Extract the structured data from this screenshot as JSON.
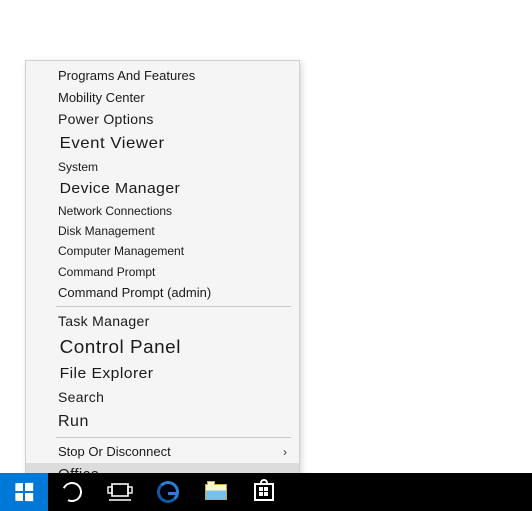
{
  "menu": {
    "items": [
      {
        "label": "Programs And Features",
        "cls": "fs-13"
      },
      {
        "label": "Mobility Center",
        "cls": "fs-13"
      },
      {
        "label": "Power Options",
        "cls": "fs-14"
      },
      {
        "label": "Event Viewer",
        "cls": "fs-16 stretch"
      },
      {
        "label": "System",
        "cls": "fs-12"
      },
      {
        "label": "Device Manager",
        "cls": "fs-15 stretch"
      },
      {
        "label": "Network Connections",
        "cls": "fs-12"
      },
      {
        "label": "Disk Management",
        "cls": "fs-12"
      },
      {
        "label": "Computer Management",
        "cls": "fs-12"
      },
      {
        "label": "Command Prompt",
        "cls": "fs-12"
      },
      {
        "label": "Command Prompt (admin)",
        "cls": "fs-13"
      },
      {
        "divider": true
      },
      {
        "label": "Task Manager",
        "cls": "fs-14"
      },
      {
        "label": "Control Panel",
        "cls": "fs-18 stretch"
      },
      {
        "label": "File Explorer",
        "cls": "fs-15 stretch"
      },
      {
        "label": "Search",
        "cls": "fs-14"
      },
      {
        "label": "Run",
        "cls": "fs-16"
      },
      {
        "divider": true
      },
      {
        "label": "Stop Or Disconnect",
        "cls": "fs-13",
        "submenu": true
      },
      {
        "label": "Office",
        "cls": "fs-15",
        "highlight": true
      }
    ]
  },
  "taskbar": {
    "start": "Start",
    "cortana": "Cortana",
    "taskview": "Task View",
    "edge": "Microsoft Edge",
    "explorer": "File Explorer",
    "store": "Store"
  }
}
